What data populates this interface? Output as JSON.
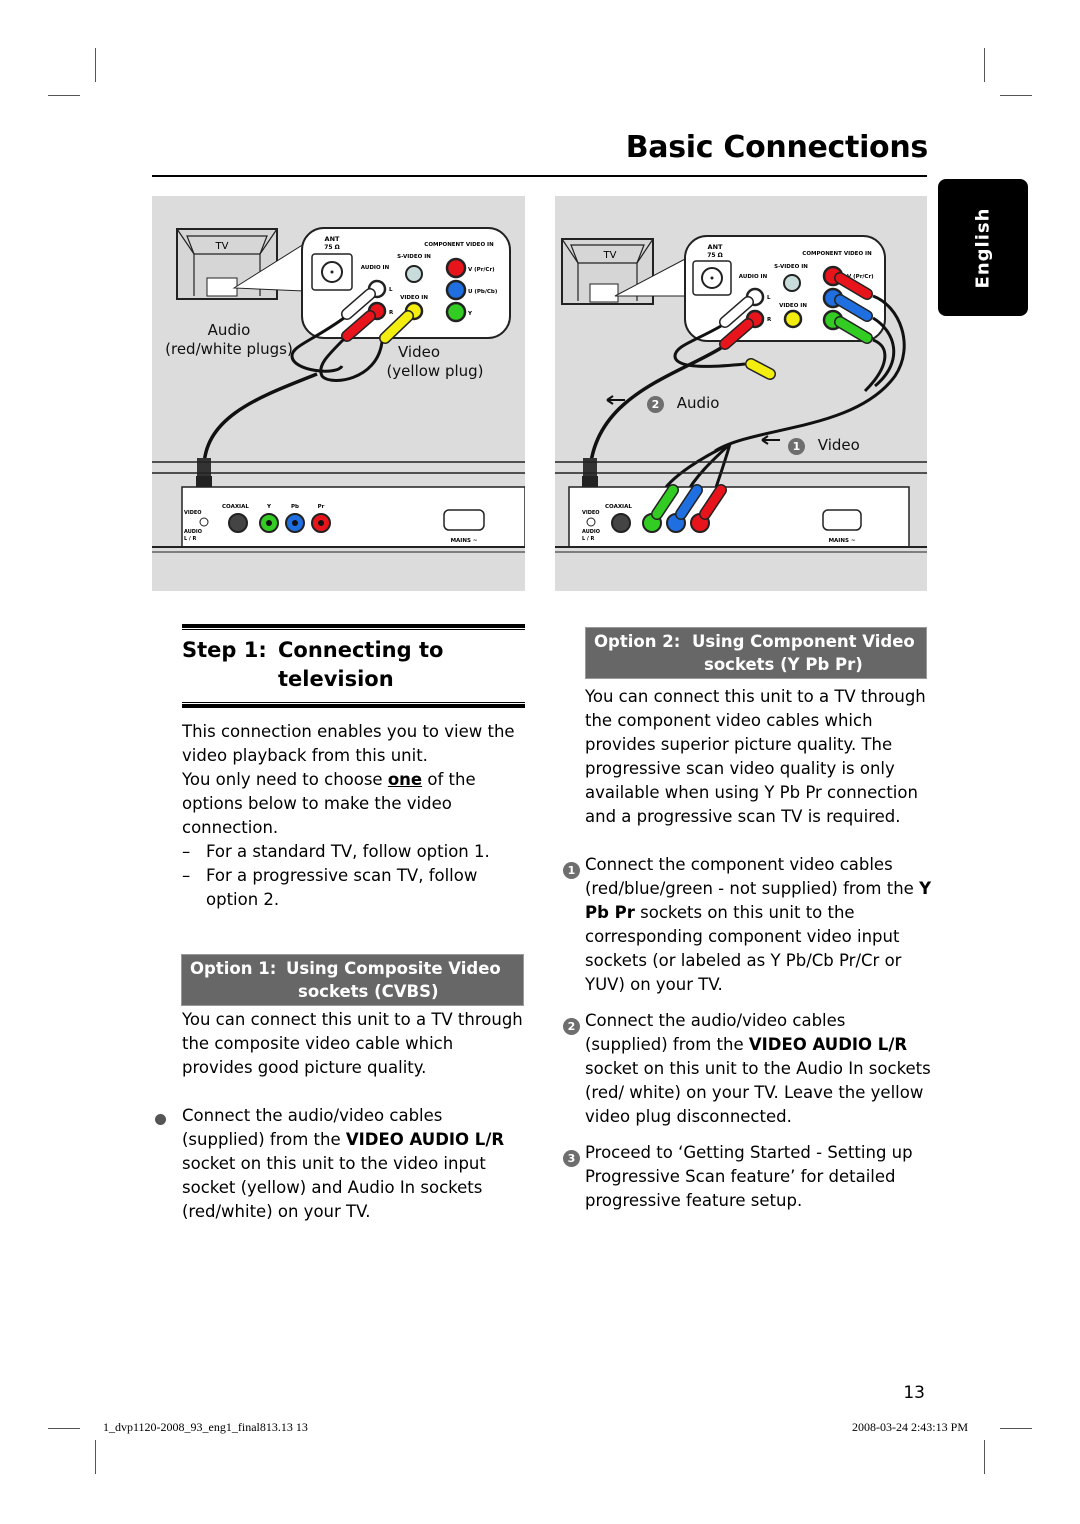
{
  "page": {
    "title": "Basic Connections",
    "language_tab": "English",
    "page_number": "13",
    "footer_left": "1_dvp1120-2008_93_eng1_final813.13   13",
    "footer_right": "2008-03-24   2:43:13 PM"
  },
  "figure_left": {
    "tv_label": "TV",
    "panel": {
      "ant": "ANT",
      "ant_spec": "75 Ω",
      "audio_in": "AUDIO IN",
      "audio_l": "L",
      "audio_r": "R",
      "svideo_in": "S-VIDEO IN",
      "video_in": "VIDEO IN",
      "component_video_in": "COMPONENT VIDEO IN",
      "v": "V (Pr/Cr)",
      "u": "U (Pb/Cb)",
      "y": "Y"
    },
    "callout_audio_1": "Audio",
    "callout_audio_2": "(red/white plugs)",
    "callout_video_1": "Video",
    "callout_video_2": "(yellow plug)",
    "unit": {
      "video": "VIDEO",
      "audio": "AUDIO",
      "lr": "L / R",
      "coaxial": "COAXIAL",
      "y": "Y",
      "pb": "Pb",
      "pr": "Pr",
      "mains": "MAINS ~"
    }
  },
  "figure_right": {
    "tv_label": "TV",
    "panel": {
      "ant": "ANT",
      "ant_spec": "75 Ω",
      "audio_in": "AUDIO IN",
      "audio_l": "L",
      "audio_r": "R",
      "svideo_in": "S-VIDEO IN",
      "video_in": "VIDEO IN",
      "component_video_in": "COMPONENT VIDEO IN",
      "v": "V (Pr/Cr)"
    },
    "callout_audio_num": "2",
    "callout_audio": "Audio",
    "callout_video_num": "1",
    "callout_video": "Video",
    "unit": {
      "video": "VIDEO",
      "audio": "AUDIO",
      "lr": "L / R",
      "coaxial": "COAXIAL",
      "mains": "MAINS ~"
    }
  },
  "step1": {
    "number": "Step 1:",
    "title_line1": "Connecting to",
    "title_line2": "television",
    "intro_1": "This connection enables you to view the video playback from this unit.",
    "intro_2a": "You only need to choose ",
    "intro_2b": "one",
    "intro_2c": " of the options below to make the video connection.",
    "dash_items": [
      "For a standard TV, follow option 1.",
      "For a progressive scan TV, follow option 2."
    ]
  },
  "option1": {
    "label": "Option 1:",
    "title_line1": "Using Composite Video",
    "title_line2": "sockets (CVBS)",
    "intro": "You can connect this unit to a TV through the composite video cable which provides good picture quality.",
    "bullet_a": "Connect the audio/video cables (supplied) from the ",
    "bullet_bold": "VIDEO AUDIO L/R",
    "bullet_b": " socket on this unit to the video input socket (yellow) and Audio In sockets (red/white) on your TV."
  },
  "option2": {
    "label": "Option 2:",
    "title_line1": "Using Component Video",
    "title_line2": "sockets (Y Pb Pr)",
    "intro": "You can connect this unit to a TV through the component video cables which provides superior picture quality. The progressive scan video quality is only available when using Y Pb Pr connection and a progressive scan TV is required.",
    "steps": [
      {
        "num": "1",
        "a": "Connect the component video cables (red/blue/green - not supplied) from the ",
        "bold": "Y Pb Pr",
        "b": " sockets on this unit to the corresponding component video input sockets (or labeled as Y Pb/Cb Pr/Cr or YUV) on your TV."
      },
      {
        "num": "2",
        "a": "Connect the audio/video cables (supplied) from the ",
        "bold": "VIDEO AUDIO L/R",
        "b": " socket on this unit to the Audio In sockets (red/ white) on your TV. Leave the yellow video plug disconnected."
      },
      {
        "num": "3",
        "a": "Proceed to ‘Getting Started - Setting up Progressive Scan feature’ for detailed progressive feature setup.",
        "bold": "",
        "b": ""
      }
    ]
  },
  "colors": {
    "figure_bg": "#dcdcdc",
    "option_bar": "#676767",
    "plug_red": "#e8141c",
    "plug_blue": "#1f6fe0",
    "plug_green": "#33cc22",
    "plug_yellow": "#f4ee10",
    "lang_tab": "#000000"
  }
}
